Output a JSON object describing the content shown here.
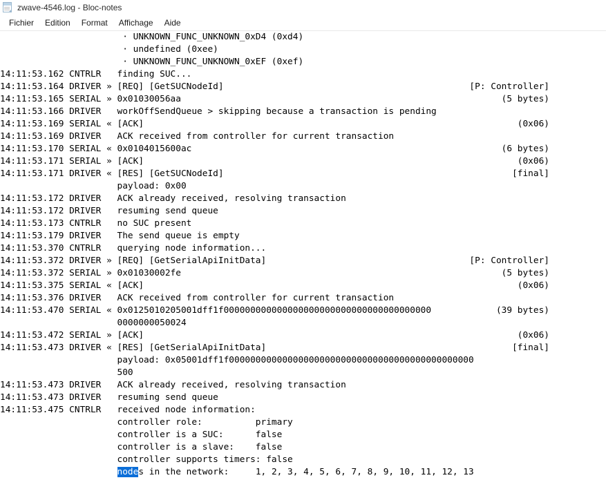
{
  "window": {
    "title": "zwave-4546.log - Bloc-notes",
    "icon": "notepad-icon"
  },
  "menu": {
    "items": [
      {
        "label": "Fichier"
      },
      {
        "label": "Edition"
      },
      {
        "label": "Format"
      },
      {
        "label": "Affichage"
      },
      {
        "label": "Aide"
      }
    ]
  },
  "selection": {
    "text": "node",
    "background": "#0b6ed8",
    "foreground": "#ffffff"
  },
  "editor": {
    "font": "monospace",
    "lines": [
      {
        "main": "                       · UNKNOWN_FUNC_UNKNOWN_0xD4 (0xd4)",
        "annot": ""
      },
      {
        "main": "                       · undefined (0xee)",
        "annot": ""
      },
      {
        "main": "                       · UNKNOWN_FUNC_UNKNOWN_0xEF (0xef)",
        "annot": ""
      },
      {
        "main": "14:11:53.162 CNTRLR   finding SUC...",
        "annot": ""
      },
      {
        "main": "14:11:53.164 DRIVER » [REQ] [GetSUCNodeId]",
        "annot": "[P: Controller]"
      },
      {
        "main": "14:11:53.165 SERIAL » 0x01030056aa",
        "annot": "(5 bytes)"
      },
      {
        "main": "14:11:53.166 DRIVER   workOffSendQueue > skipping because a transaction is pending",
        "annot": ""
      },
      {
        "main": "14:11:53.169 SERIAL « [ACK]",
        "annot": "(0x06)"
      },
      {
        "main": "14:11:53.169 DRIVER   ACK received from controller for current transaction",
        "annot": ""
      },
      {
        "main": "14:11:53.170 SERIAL « 0x0104015600ac",
        "annot": "(6 bytes)"
      },
      {
        "main": "14:11:53.171 SERIAL » [ACK]",
        "annot": "(0x06)"
      },
      {
        "main": "14:11:53.171 DRIVER « [RES] [GetSUCNodeId]",
        "annot": "[final]"
      },
      {
        "main": "                      payload: 0x00",
        "annot": ""
      },
      {
        "main": "14:11:53.172 DRIVER   ACK already received, resolving transaction",
        "annot": ""
      },
      {
        "main": "14:11:53.172 DRIVER   resuming send queue",
        "annot": ""
      },
      {
        "main": "14:11:53.173 CNTRLR   no SUC present",
        "annot": ""
      },
      {
        "main": "14:11:53.179 DRIVER   The send queue is empty",
        "annot": ""
      },
      {
        "main": "14:11:53.370 CNTRLR   querying node information...",
        "annot": ""
      },
      {
        "main": "14:11:53.372 DRIVER » [REQ] [GetSerialApiInitData]",
        "annot": "[P: Controller]"
      },
      {
        "main": "14:11:53.372 SERIAL » 0x01030002fe",
        "annot": "(5 bytes)"
      },
      {
        "main": "14:11:53.375 SERIAL « [ACK]",
        "annot": "(0x06)"
      },
      {
        "main": "14:11:53.376 DRIVER   ACK received from controller for current transaction",
        "annot": ""
      },
      {
        "main": "14:11:53.470 SERIAL « 0x0125010205001dff1f000000000000000000000000000000000000000",
        "annot": "(39 bytes)"
      },
      {
        "main": "                      0000000050024",
        "annot": ""
      },
      {
        "main": "14:11:53.472 SERIAL » [ACK]",
        "annot": "(0x06)"
      },
      {
        "main": "14:11:53.473 DRIVER « [RES] [GetSerialApiInitData]",
        "annot": "[final]"
      },
      {
        "main": "                      payload: 0x05001dff1f0000000000000000000000000000000000000000000000",
        "annot": ""
      },
      {
        "main": "                      500",
        "annot": ""
      },
      {
        "main": "14:11:53.473 DRIVER   ACK already received, resolving transaction",
        "annot": ""
      },
      {
        "main": "14:11:53.473 DRIVER   resuming send queue",
        "annot": ""
      },
      {
        "main": "14:11:53.475 CNTRLR   received node information:",
        "annot": ""
      },
      {
        "main": "                      controller role:          primary",
        "annot": ""
      },
      {
        "main": "                      controller is a SUC:      false",
        "annot": ""
      },
      {
        "main": "                      controller is a slave:    false",
        "annot": ""
      },
      {
        "main": "                      controller supports timers: false",
        "annot": ""
      },
      {
        "main": "                      nodes in the network:     1, 2, 3, 4, 5, 6, 7, 8, 9, 10, 11, 12, 13",
        "annot": "",
        "selection": {
          "start": 22,
          "length": 4
        }
      }
    ]
  }
}
